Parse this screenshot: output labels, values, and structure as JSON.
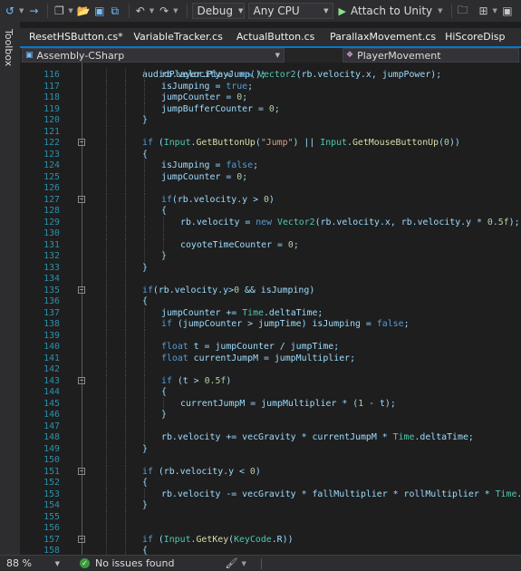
{
  "toolbar": {
    "config": "Debug",
    "platform": "Any CPU",
    "run_label": "Attach to Unity"
  },
  "sidebar": {
    "toolbox": "Toolbox"
  },
  "tabs": [
    {
      "label": "ResetHSButton.cs*",
      "active": false
    },
    {
      "label": "VariableTracker.cs",
      "active": false
    },
    {
      "label": "ActualButton.cs",
      "active": false
    },
    {
      "label": "ParallaxMovement.cs",
      "active": false
    },
    {
      "label": "HiScoreDisp",
      "active": false
    }
  ],
  "navbar": {
    "project": "Assembly-CSharp",
    "member": "PlayerMovement"
  },
  "code": {
    "first_partial": "audioPlayer.PlayJump();",
    "lines": [
      {
        "n": "116",
        "indent": 4,
        "tokens": [
          [
            "v",
            "rb.velocity = "
          ],
          [
            "k",
            "new "
          ],
          [
            "t",
            "Vector2"
          ],
          [
            "v",
            "(rb.velocity.x, jumpPower);"
          ]
        ]
      },
      {
        "n": "117",
        "indent": 4,
        "tokens": [
          [
            "v",
            "isJumping = "
          ],
          [
            "k",
            "true"
          ],
          [
            "v",
            ";"
          ]
        ]
      },
      {
        "n": "118",
        "indent": 4,
        "tokens": [
          [
            "v",
            "jumpCounter = "
          ],
          [
            "n",
            "0"
          ],
          [
            "v",
            ";"
          ]
        ]
      },
      {
        "n": "119",
        "indent": 4,
        "tokens": [
          [
            "v",
            "jumpBufferCounter = "
          ],
          [
            "n",
            "0"
          ],
          [
            "v",
            ";"
          ]
        ]
      },
      {
        "n": "120",
        "indent": 3,
        "tokens": [
          [
            "v",
            "}"
          ]
        ]
      },
      {
        "n": "121",
        "indent": 3,
        "tokens": []
      },
      {
        "n": "122",
        "indent": 3,
        "fold": true,
        "tokens": [
          [
            "k",
            "if "
          ],
          [
            "v",
            "("
          ],
          [
            "t",
            "Input"
          ],
          [
            "v",
            "."
          ],
          [
            "m",
            "GetButtonUp"
          ],
          [
            "v",
            "("
          ],
          [
            "s",
            "\"Jump\""
          ],
          [
            "v",
            ") || "
          ],
          [
            "t",
            "Input"
          ],
          [
            "v",
            "."
          ],
          [
            "m",
            "GetMouseButtonUp"
          ],
          [
            "v",
            "("
          ],
          [
            "n",
            "0"
          ],
          [
            "v",
            "))"
          ]
        ]
      },
      {
        "n": "123",
        "indent": 3,
        "tokens": [
          [
            "v",
            "{"
          ]
        ]
      },
      {
        "n": "124",
        "indent": 4,
        "tokens": [
          [
            "v",
            "isJumping = "
          ],
          [
            "k",
            "false"
          ],
          [
            "v",
            ";"
          ]
        ]
      },
      {
        "n": "125",
        "indent": 4,
        "tokens": [
          [
            "v",
            "jumpCounter = "
          ],
          [
            "n",
            "0"
          ],
          [
            "v",
            ";"
          ]
        ]
      },
      {
        "n": "126",
        "indent": 4,
        "tokens": []
      },
      {
        "n": "127",
        "indent": 4,
        "fold": true,
        "tokens": [
          [
            "k",
            "if"
          ],
          [
            "v",
            "(rb.velocity.y > "
          ],
          [
            "n",
            "0"
          ],
          [
            "v",
            ")"
          ]
        ]
      },
      {
        "n": "128",
        "indent": 4,
        "tokens": [
          [
            "v",
            "{"
          ]
        ]
      },
      {
        "n": "129",
        "indent": 5,
        "tokens": [
          [
            "v",
            "rb.velocity = "
          ],
          [
            "k",
            "new "
          ],
          [
            "t",
            "Vector2"
          ],
          [
            "v",
            "(rb.velocity.x, rb.velocity.y * "
          ],
          [
            "n",
            "0.5f"
          ],
          [
            "v",
            ");"
          ]
        ]
      },
      {
        "n": "130",
        "indent": 5,
        "tokens": []
      },
      {
        "n": "131",
        "indent": 5,
        "tokens": [
          [
            "v",
            "coyoteTimeCounter = "
          ],
          [
            "n",
            "0"
          ],
          [
            "v",
            ";"
          ]
        ]
      },
      {
        "n": "132",
        "indent": 4,
        "tokens": [
          [
            "v",
            "}"
          ]
        ]
      },
      {
        "n": "133",
        "indent": 3,
        "tokens": [
          [
            "v",
            "}"
          ]
        ]
      },
      {
        "n": "134",
        "indent": 3,
        "tokens": []
      },
      {
        "n": "135",
        "indent": 3,
        "fold": true,
        "tokens": [
          [
            "k",
            "if"
          ],
          [
            "v",
            "(rb.velocity.y>"
          ],
          [
            "n",
            "0"
          ],
          [
            "v",
            " && isJumping)"
          ]
        ]
      },
      {
        "n": "136",
        "indent": 3,
        "tokens": [
          [
            "v",
            "{"
          ]
        ]
      },
      {
        "n": "137",
        "indent": 4,
        "tokens": [
          [
            "v",
            "jumpCounter += "
          ],
          [
            "t",
            "Time"
          ],
          [
            "v",
            ".deltaTime;"
          ]
        ]
      },
      {
        "n": "138",
        "indent": 4,
        "tokens": [
          [
            "k",
            "if "
          ],
          [
            "v",
            "(jumpCounter > jumpTime) isJumping = "
          ],
          [
            "k",
            "false"
          ],
          [
            "v",
            ";"
          ]
        ]
      },
      {
        "n": "139",
        "indent": 4,
        "tokens": []
      },
      {
        "n": "140",
        "indent": 4,
        "tokens": [
          [
            "k",
            "float "
          ],
          [
            "v",
            "t = jumpCounter / jumpTime;"
          ]
        ]
      },
      {
        "n": "141",
        "indent": 4,
        "tokens": [
          [
            "k",
            "float "
          ],
          [
            "v",
            "currentJumpM = jumpMultiplier;"
          ]
        ]
      },
      {
        "n": "142",
        "indent": 4,
        "tokens": []
      },
      {
        "n": "143",
        "indent": 4,
        "fold": true,
        "tokens": [
          [
            "k",
            "if "
          ],
          [
            "v",
            "(t > "
          ],
          [
            "n",
            "0.5f"
          ],
          [
            "v",
            ")"
          ]
        ]
      },
      {
        "n": "144",
        "indent": 4,
        "tokens": [
          [
            "v",
            "{"
          ]
        ]
      },
      {
        "n": "145",
        "indent": 5,
        "tokens": [
          [
            "v",
            "currentJumpM = jumpMultiplier * ("
          ],
          [
            "n",
            "1"
          ],
          [
            "v",
            " - t);"
          ]
        ]
      },
      {
        "n": "146",
        "indent": 4,
        "tokens": [
          [
            "v",
            "}"
          ]
        ]
      },
      {
        "n": "147",
        "indent": 4,
        "tokens": []
      },
      {
        "n": "148",
        "indent": 4,
        "tokens": [
          [
            "v",
            "rb.velocity += vecGravity * currentJumpM * "
          ],
          [
            "t",
            "Time"
          ],
          [
            "v",
            ".deltaTime;"
          ]
        ]
      },
      {
        "n": "149",
        "indent": 3,
        "tokens": [
          [
            "v",
            "}"
          ]
        ]
      },
      {
        "n": "150",
        "indent": 3,
        "tokens": []
      },
      {
        "n": "151",
        "indent": 3,
        "fold": true,
        "tokens": [
          [
            "k",
            "if "
          ],
          [
            "v",
            "(rb.velocity.y < "
          ],
          [
            "n",
            "0"
          ],
          [
            "v",
            ")"
          ]
        ]
      },
      {
        "n": "152",
        "indent": 3,
        "tokens": [
          [
            "v",
            "{"
          ]
        ]
      },
      {
        "n": "153",
        "indent": 4,
        "tokens": [
          [
            "v",
            "rb.velocity -= vecGravity * fallMultiplier * rollMultiplier * "
          ],
          [
            "t",
            "Time"
          ],
          [
            "v",
            ".deltaTime;"
          ]
        ]
      },
      {
        "n": "154",
        "indent": 3,
        "tokens": [
          [
            "v",
            "}"
          ]
        ]
      },
      {
        "n": "155",
        "indent": 3,
        "tokens": []
      },
      {
        "n": "156",
        "indent": 3,
        "tokens": []
      },
      {
        "n": "157",
        "indent": 3,
        "fold": true,
        "tokens": [
          [
            "k",
            "if "
          ],
          [
            "v",
            "("
          ],
          [
            "t",
            "Input"
          ],
          [
            "v",
            "."
          ],
          [
            "m",
            "GetKey"
          ],
          [
            "v",
            "("
          ],
          [
            "t",
            "KeyCode"
          ],
          [
            "v",
            ".R))"
          ]
        ]
      },
      {
        "n": "158",
        "indent": 3,
        "tokens": [
          [
            "v",
            "{"
          ]
        ]
      }
    ]
  },
  "status": {
    "zoom": "88 %",
    "issues": "No issues found"
  },
  "colors": {
    "keyword": "#569cd6",
    "type": "#4ec9b0",
    "string": "#d69d85",
    "number": "#b5cea8",
    "method": "#dcdcaa",
    "identifier": "#9cdcfe",
    "accent": "#007acc"
  }
}
